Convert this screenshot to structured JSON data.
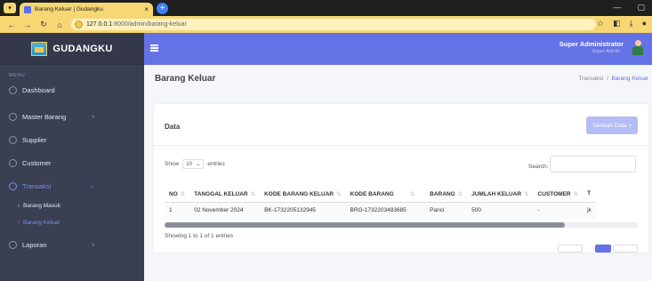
{
  "browser": {
    "tab_title": "Barang Keluar | Gudangku",
    "tab_close": "×",
    "new_tab": "+",
    "url_host": "127.0.0.1",
    "url_path": ":8000/admin/barang-keluar"
  },
  "sidebar": {
    "brand": "GUDANGKU",
    "menu_heading": "MENU",
    "items": [
      {
        "label": "Dashboard"
      },
      {
        "label": "Master Barang"
      },
      {
        "label": "Supplier"
      },
      {
        "label": "Customer"
      },
      {
        "label": "Transaksi"
      },
      {
        "label": "Laporan"
      }
    ],
    "sub_items": [
      {
        "label": "Barang Masuk"
      },
      {
        "label": "Barang Keluar"
      }
    ]
  },
  "header": {
    "user_name": "Super Administrator",
    "user_role": "Super Admin"
  },
  "page": {
    "title": "Barang Keluar",
    "breadcrumb_parent": "Transaksi",
    "breadcrumb_sep": "/",
    "breadcrumb_current": "Barang Keluar"
  },
  "card": {
    "title": "Data",
    "add_button": "Tambah Data +",
    "show_label": "Show",
    "entries_value": "10",
    "entries_label": "entries",
    "search_label": "Search:",
    "info": "Showing 1 to 1 of 1 entries"
  },
  "table": {
    "columns": [
      "NO",
      "TANGGAL KELUAR",
      "KODE BARANG KELUAR",
      "KODE BARANG",
      "BARANG",
      "JUMLAH KELUAR",
      "CUSTOMER",
      "T"
    ],
    "rows": [
      [
        "1",
        "02 November 2024",
        "BK-1732205132945",
        "BRG-1732203483685",
        "Panci",
        "500",
        "-",
        "jk"
      ]
    ]
  },
  "colors": {
    "accent": "#6572e6",
    "sidebar_bg": "#3a3f51",
    "browser_theme": "#f7d774"
  }
}
